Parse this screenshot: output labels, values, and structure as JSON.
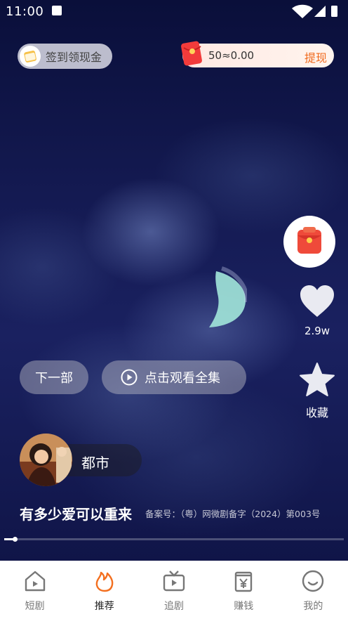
{
  "status_bar": {
    "time": "11:00"
  },
  "top": {
    "checkin_label": "签到领现金",
    "reward_balance": "50≈0.00",
    "withdraw_label": "提现"
  },
  "side_actions": {
    "like_count": "2.9w",
    "favorite_label": "收藏"
  },
  "player": {
    "next_label": "下一部",
    "watch_all_label": "点击观看全集",
    "genre": "都市",
    "title": "有多少爱可以重来",
    "record_number": "备案号：（粤）网微剧备字（2024）第003号",
    "progress": 0.03
  },
  "nav": {
    "items": [
      {
        "label": "短剧",
        "icon": "home-icon"
      },
      {
        "label": "推荐",
        "icon": "flame-icon"
      },
      {
        "label": "追剧",
        "icon": "tv-icon"
      },
      {
        "label": "赚钱",
        "icon": "yen-card-icon"
      },
      {
        "label": "我的",
        "icon": "smile-icon"
      }
    ],
    "active_index": 1
  },
  "colors": {
    "accent": "#f06a1d",
    "active_icon": "#f36f1f",
    "inactive_icon": "#777777"
  }
}
